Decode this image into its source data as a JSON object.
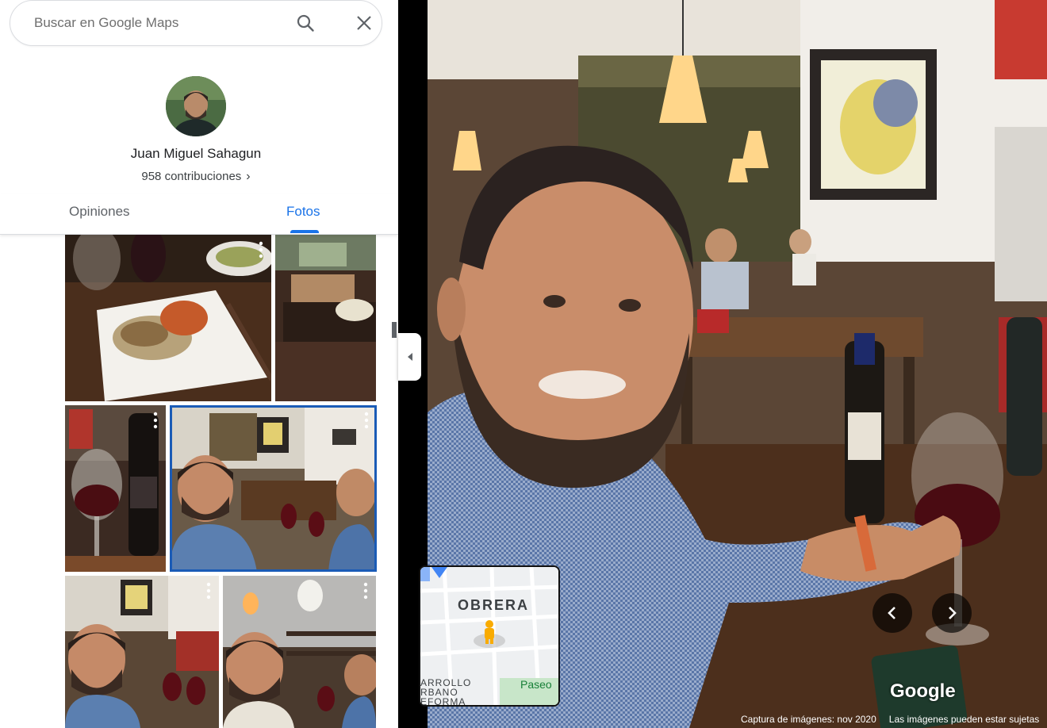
{
  "search": {
    "placeholder": "Buscar en Google Maps"
  },
  "icons": {
    "search": "search-icon",
    "close": "close-icon",
    "chevron": "chevron-right-icon",
    "collapse": "chevron-left-icon"
  },
  "profile": {
    "name": "Juan Miguel Sahagun",
    "contributions": "958 contribuciones"
  },
  "tabs": [
    {
      "label": "Opiniones",
      "active": false
    },
    {
      "label": "Fotos",
      "active": true
    }
  ],
  "photos": [
    {
      "subject": "pasta plate with wine"
    },
    {
      "subject": "restaurant interior with box"
    },
    {
      "subject": "wine glass and bottle"
    },
    {
      "subject": "selfie at restaurant table",
      "selected": true
    },
    {
      "subject": "selfie with wine in restaurant"
    },
    {
      "subject": "selfie near wine shelves"
    }
  ],
  "minimap": {
    "area": "OBRERA",
    "district_lines": [
      "ARROLLO",
      "RBANO",
      "EFORMA"
    ],
    "street": "Paseo"
  },
  "viewer": {
    "logo": "Google",
    "capture": "Captura de imágenes: nov 2020",
    "notice": "Las imágenes pueden estar sujetas"
  },
  "colors": {
    "accent": "#1a73e8",
    "selected_outline": "#1a5bb6"
  }
}
